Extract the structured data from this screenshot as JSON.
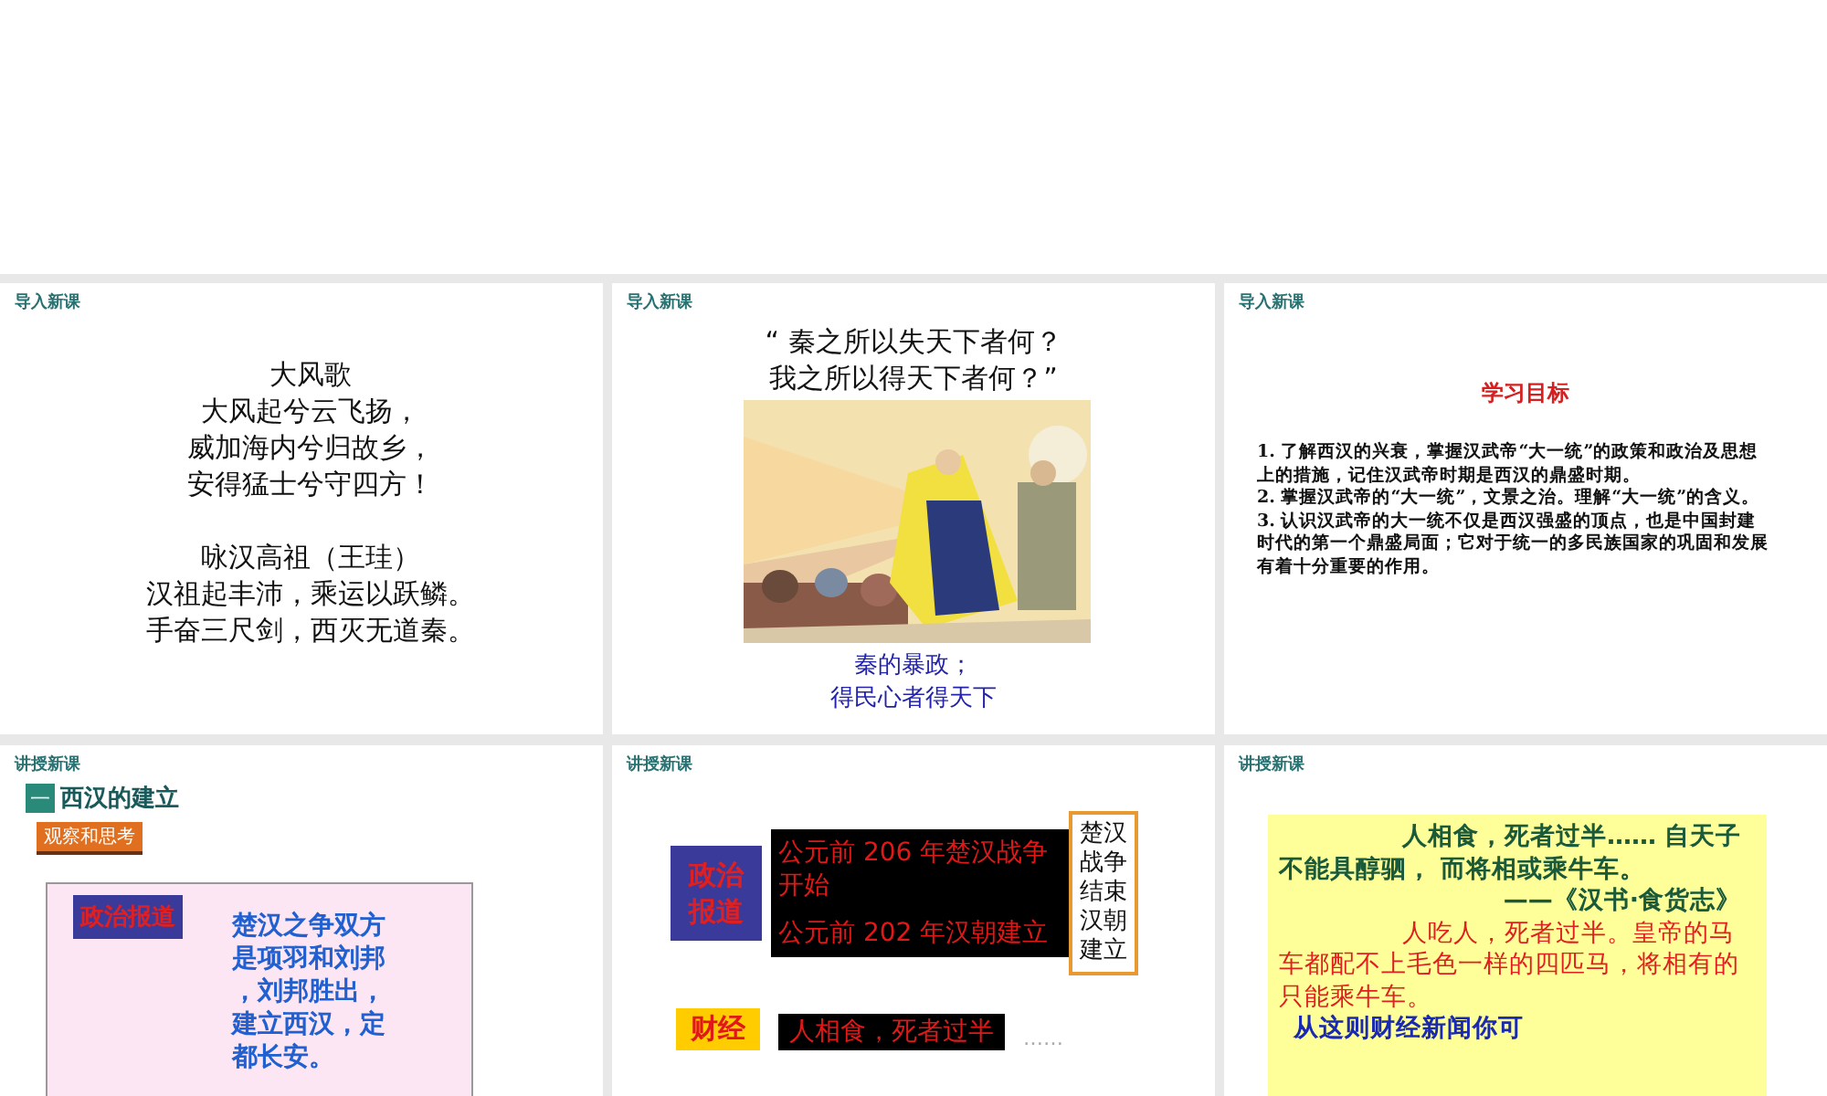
{
  "slides": [
    {
      "kind": "poem",
      "header": "导入新课",
      "stanzas": [
        [
          "大风歌",
          "大风起兮云飞扬，",
          "威加海内兮归故乡，",
          "安得猛士兮守四方！"
        ],
        [
          "咏汉高祖（王珪）",
          "汉祖起丰沛，乘运以跃鳞。",
          "手奋三尺剑，西灭无道秦。"
        ]
      ]
    },
    {
      "kind": "quote_picture",
      "header": "导入新课",
      "quote": [
        "“ 秦之所以失天下者何？",
        "我之所以得天下者何？”"
      ],
      "picture": {
        "kind": "picture"
      },
      "caption": [
        "秦的暴政；",
        "得民心者得天下"
      ]
    },
    {
      "kind": "objectives",
      "header": "导入新课",
      "title": "学习目标",
      "items": [
        "1. 了解西汉的兴衰，掌握汉武帝“大一统”的政策和政治及思想上的措施，记住汉武帝时期是西汉的鼎盛时期。",
        "2. 掌握汉武帝的“大一统”，文景之治。理解“大一统”的含义。",
        "3. 认识汉武帝的大一统不仅是西汉强盛的顶点，也是中国封建时代的第一个鼎盛局面；它对于统一的多民族国家的巩固和发展有着十分重要的作用。"
      ]
    },
    {
      "kind": "section",
      "header": "讲授新课",
      "number": "一",
      "title": "西汉的建立",
      "tag": "观察和思考",
      "label": "政治报道",
      "body": [
        "楚汉之争双方",
        "是项羽和刘邦",
        "，刘邦胜出，",
        "建立西汉，定",
        "都长安。"
      ]
    },
    {
      "kind": "reports",
      "header": "讲授新课",
      "label": "政治报道",
      "events": [
        "公元前 206 年楚汉战争开始",
        "公元前 202 年汉朝建立"
      ],
      "note": "楚汉战争结束汉朝建立",
      "label2": "财经",
      "text2": "人相食，死者过半",
      "dots": "……"
    },
    {
      "kind": "quote_box",
      "header": "讲授新课",
      "quote": "人相食，死者过半…… 自天子不能具醇驷， 而将相或乘牛车。",
      "source": "——《汉书·食货志》",
      "translation": "人吃人，死者过半。皇帝的马车都配不上毛色一样的四匹马，将相有的只能乘牛车。",
      "question": "从这则财经新闻你可"
    }
  ]
}
